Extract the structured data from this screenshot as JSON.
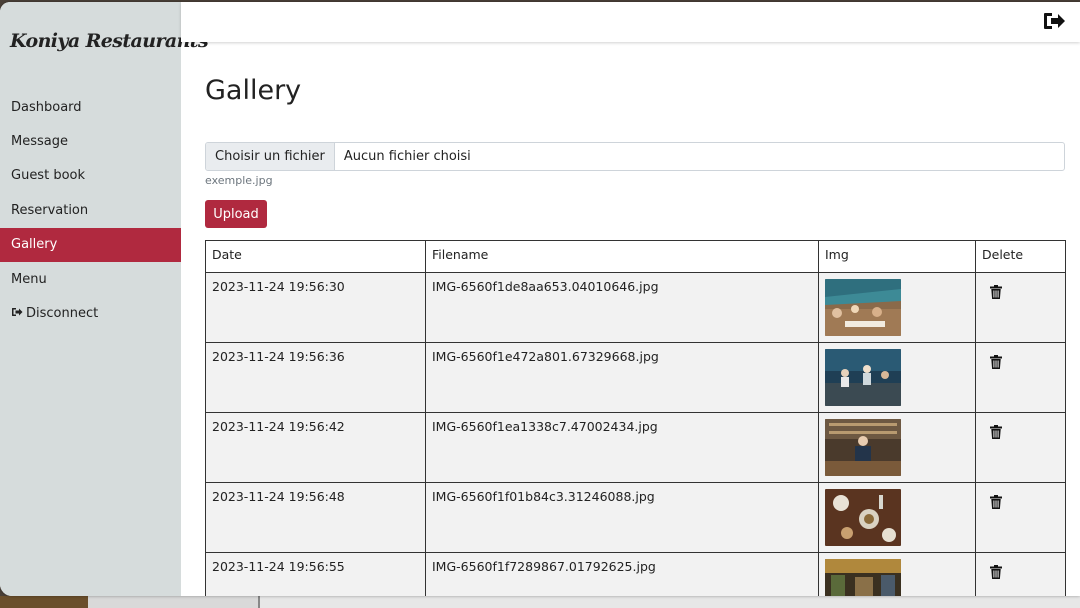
{
  "app": {
    "brand": "Koniya Restaurants"
  },
  "sidebar": {
    "items": [
      {
        "label": "Dashboard"
      },
      {
        "label": "Message"
      },
      {
        "label": "Guest book"
      },
      {
        "label": "Reservation"
      },
      {
        "label": "Gallery",
        "active": true
      },
      {
        "label": "Menu"
      },
      {
        "label": "Disconnect",
        "icon": "sign-out-icon"
      }
    ]
  },
  "topbar": {
    "logout_icon": "sign-out-icon"
  },
  "page": {
    "title": "Gallery",
    "file_input": {
      "button_label": "Choisir un fichier",
      "value": "Aucun fichier choisi"
    },
    "file_hint": "exemple.jpg",
    "upload_label": "Upload"
  },
  "table": {
    "headers": [
      "Date",
      "Filename",
      "Img",
      "Delete"
    ],
    "rows": [
      {
        "date": "2023-11-24 19:56:30",
        "filename": "IMG-6560f1de8aa653.04010646.jpg",
        "img": "restaurant-terrace-photo"
      },
      {
        "date": "2023-11-24 19:56:36",
        "filename": "IMG-6560f1e472a801.67329668.jpg",
        "img": "bar-counter-photo"
      },
      {
        "date": "2023-11-24 19:56:42",
        "filename": "IMG-6560f1ea1338c7.47002434.jpg",
        "img": "bartender-photo"
      },
      {
        "date": "2023-11-24 19:56:48",
        "filename": "IMG-6560f1f01b84c3.31246088.jpg",
        "img": "table-food-photo"
      },
      {
        "date": "2023-11-24 19:56:55",
        "filename": "IMG-6560f1f7289867.01792625.jpg",
        "img": "restaurant-interior-photo"
      }
    ]
  },
  "colors": {
    "accent": "#b0293f",
    "sidebar_bg": "#d6dcdc",
    "row_bg": "#f2f2f2"
  }
}
